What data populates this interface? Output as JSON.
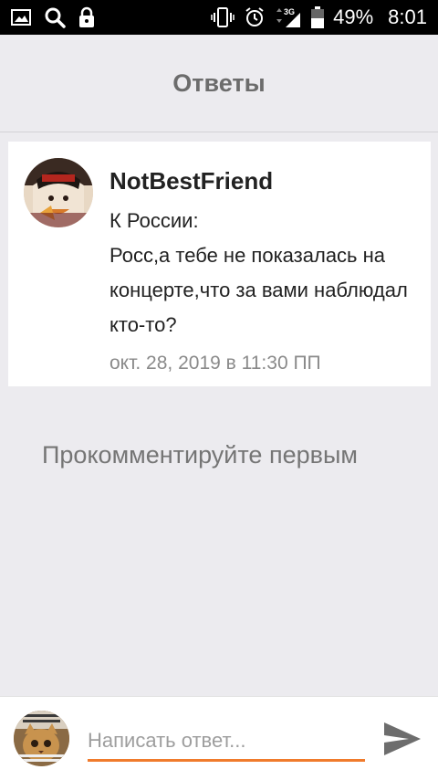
{
  "status_bar": {
    "battery": "49%",
    "time": "8:01",
    "network": "3G",
    "icons_left": [
      "gallery-icon",
      "search-icon",
      "lock-icon"
    ],
    "icons_right": [
      "vibrate-icon",
      "alarm-icon",
      "network-icon",
      "signal-icon",
      "battery-icon"
    ]
  },
  "header": {
    "title": "Ответы"
  },
  "post": {
    "author": "NotBestFriend",
    "lines": [
      "К России:",
      "Росс,а тебе не показалась на концерте,что за вами наблюдал кто-то?"
    ],
    "date": "окт. 28, 2019 в 11:30 ПП"
  },
  "empty_state": {
    "text": "Прокомментируйте первым"
  },
  "reply": {
    "placeholder": "Написать ответ...",
    "accent_color": "#f07b2c"
  },
  "colors": {
    "background": "#ecebef",
    "card": "#ffffff",
    "title": "#6c6c6c",
    "muted": "#8a8a8a"
  }
}
